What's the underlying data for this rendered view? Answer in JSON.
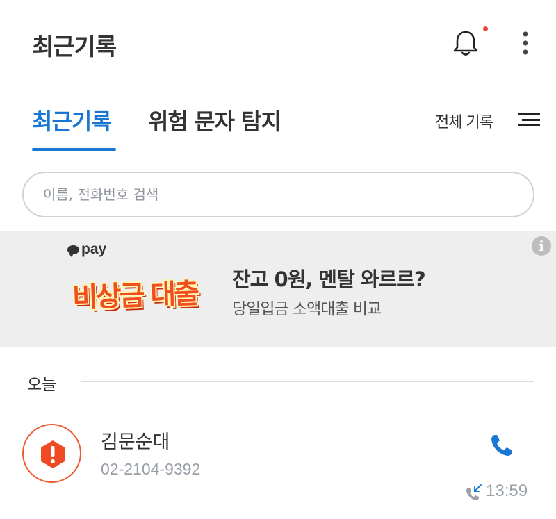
{
  "header": {
    "title": "최근기록",
    "icons": [
      "bell-icon",
      "more-vertical-icon"
    ],
    "notification_dot_color": "#f0443a"
  },
  "tabs": [
    {
      "label": "최근기록",
      "active": true
    },
    {
      "label": "위험 문자 탐지",
      "active": false
    }
  ],
  "filter": {
    "label": "전체 기록",
    "icon": "menu-lines-icon"
  },
  "accent_color": "#1976d2",
  "search": {
    "placeholder": "이름, 전화번호 검색",
    "value": ""
  },
  "ad": {
    "brand": "pay",
    "logo_text": "비상금 대출",
    "title": "잔고 0원, 멘탈 와르르?",
    "subtitle": "당일입금 소액대출 비교",
    "info_icon": "info-icon"
  },
  "section": {
    "title": "오늘"
  },
  "calls": [
    {
      "name": "김문순대",
      "number": "02-2104-9392",
      "time": "13:59",
      "type": "incoming",
      "status_icon": "spam-warning-icon",
      "status_color": "#ef5a33"
    }
  ]
}
